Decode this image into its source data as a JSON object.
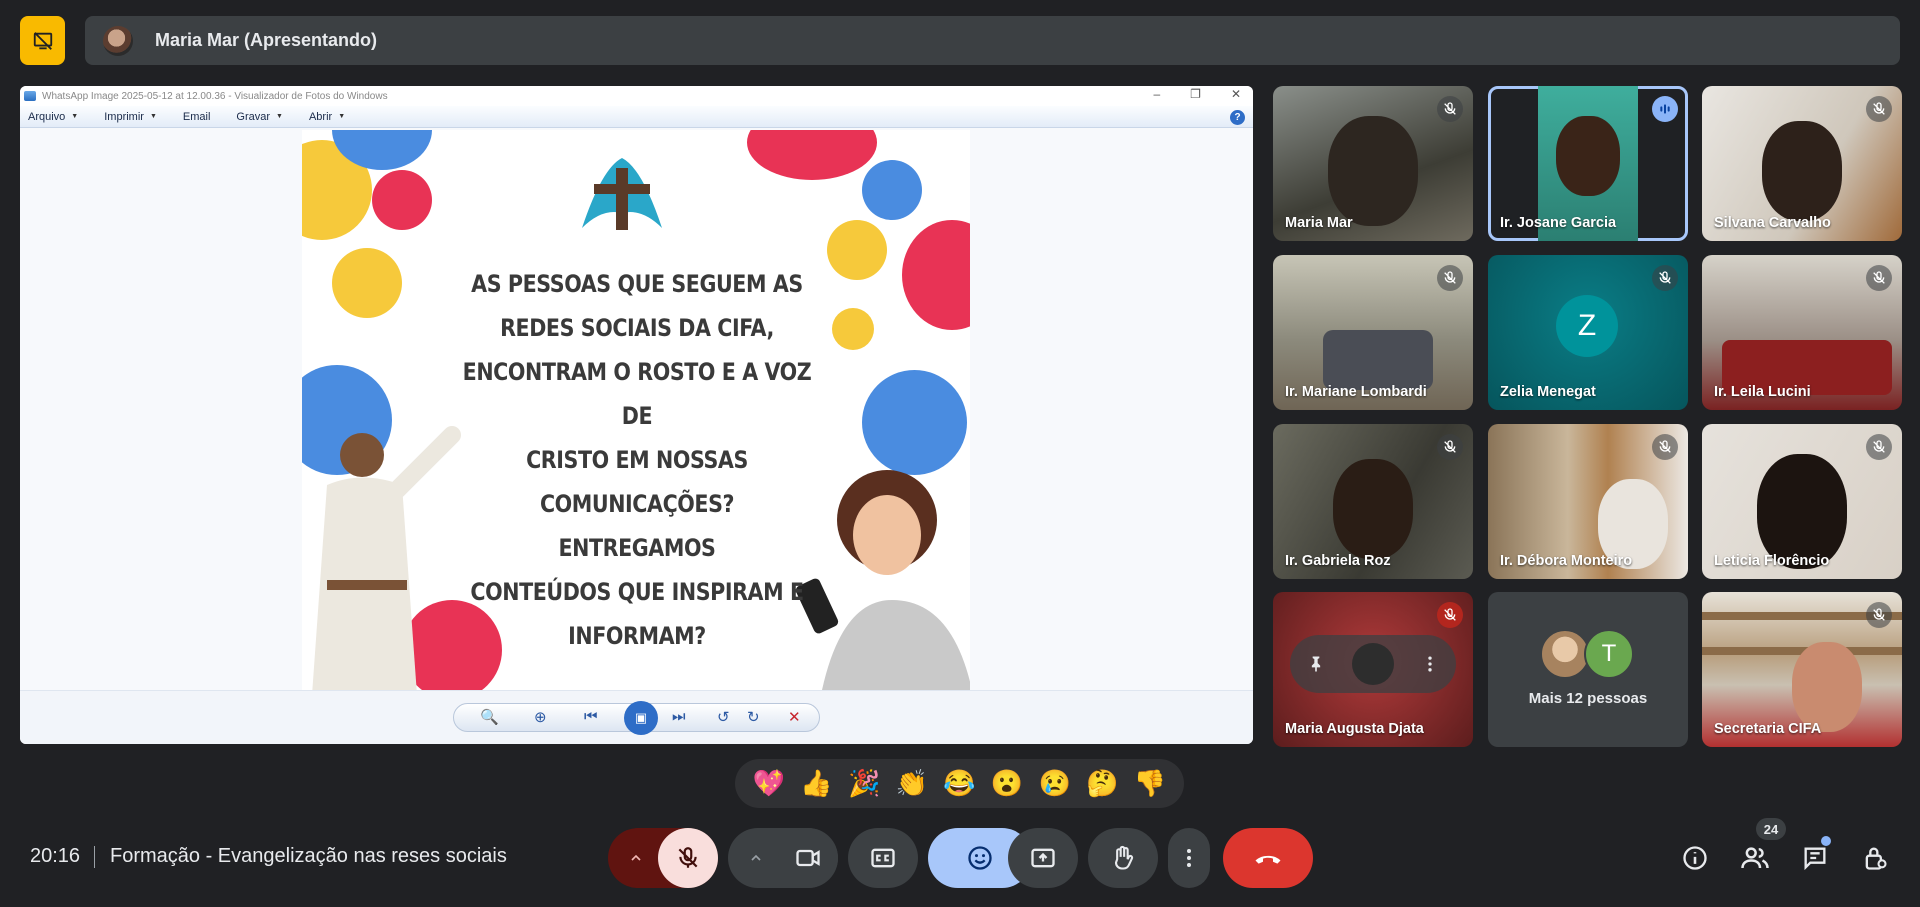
{
  "header": {
    "presenter_label": "Maria Mar (Apresentando)"
  },
  "viewer": {
    "window_title": "WhatsApp Image 2025-05-12 at 12.00.36 - Visualizador de Fotos do Windows",
    "menu": [
      "Arquivo",
      "Imprimir",
      "Email",
      "Gravar",
      "Abrir"
    ],
    "help_glyph": "?",
    "slide_text": [
      "AS PESSOAS QUE SEGUEM AS",
      "REDES SOCIAIS DA CIFA,",
      "ENCONTRAM O ROSTO E A VOZ DE",
      "CRISTO EM NOSSAS",
      "COMUNICAÇÕES? ENTREGAMOS",
      "CONTEÚDOS QUE INSPIRAM E",
      "INFORMAM?"
    ]
  },
  "participants": [
    {
      "name": "Maria Mar",
      "muted": true
    },
    {
      "name": "Ir. Josane Garcia",
      "speaking": true
    },
    {
      "name": "Silvana Carvalho",
      "muted": true
    },
    {
      "name": "Ir. Mariane Lombardi",
      "muted": true
    },
    {
      "name": "Zelia Menegat",
      "muted": true,
      "initial": "Z"
    },
    {
      "name": "Ir. Leila Lucini",
      "muted": true
    },
    {
      "name": "Ir. Gabriela Roz",
      "muted": true
    },
    {
      "name": "Ir. Débora Monteiro",
      "muted": true
    },
    {
      "name": "Leticia Florêncio",
      "muted": true
    },
    {
      "name": "Maria Augusta Djata",
      "muted": true
    },
    {
      "name": "Mais 12 pessoas",
      "initial": "T"
    },
    {
      "name": "Secretaria CIFA",
      "muted": true
    }
  ],
  "reactions": [
    "💖",
    "👍",
    "🎉",
    "👏",
    "😂",
    "😮",
    "😢",
    "🤔",
    "👎"
  ],
  "footer": {
    "time": "20:16",
    "meeting_title": "Formação - Evangelização nas reses sociais",
    "people_count": "24"
  },
  "colors": {
    "accent_yellow": "#f9ba00",
    "leave_red": "#dc362e",
    "reaction_blue": "#a8c7fa",
    "active_outline": "#a8c7fa"
  }
}
